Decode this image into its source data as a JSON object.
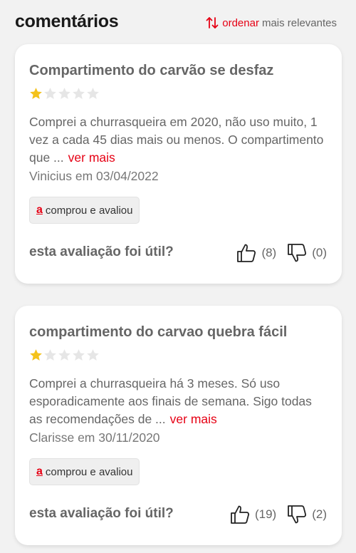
{
  "header": {
    "title": "comentários",
    "sort_label": "ordenar",
    "sort_value": "mais relevantes",
    "accent_color": "#e60014"
  },
  "reviews": [
    {
      "title": "Compartimento do carvão se desfaz",
      "rating": 1,
      "max_rating": 5,
      "text": "Comprei a churrasqueira em 2020, não uso muito, 1 vez a cada 45 dias mais ou menos. O compartimento que ...",
      "more_label": "ver mais",
      "author_date": "Vinicius em 03/04/2022",
      "badge_icon": "a",
      "badge_label": "comprou e avaliou",
      "helpful_label": "esta avaliação foi útil?",
      "likes": "(8)",
      "dislikes": "(0)"
    },
    {
      "title": "compartimento do carvao quebra fácil",
      "rating": 1,
      "max_rating": 5,
      "text": "Comprei a churrasqueira há 3 meses. Só uso esporadicamente aos finais de semana. Sigo todas as recomendações de ...",
      "more_label": "ver mais",
      "author_date": "Clarisse em 30/11/2020",
      "badge_icon": "a",
      "badge_label": "comprou e avaliou",
      "helpful_label": "esta avaliação foi útil?",
      "likes": "(19)",
      "dislikes": "(2)"
    }
  ],
  "icons": {
    "sort": "sort-arrows-icon",
    "star_filled": "star-filled-icon",
    "star_empty": "star-empty-icon",
    "thumbs_up": "thumbs-up-icon",
    "thumbs_down": "thumbs-down-icon"
  },
  "colors": {
    "star_filled": "#f4c21b",
    "star_empty": "#e6e6e6"
  }
}
